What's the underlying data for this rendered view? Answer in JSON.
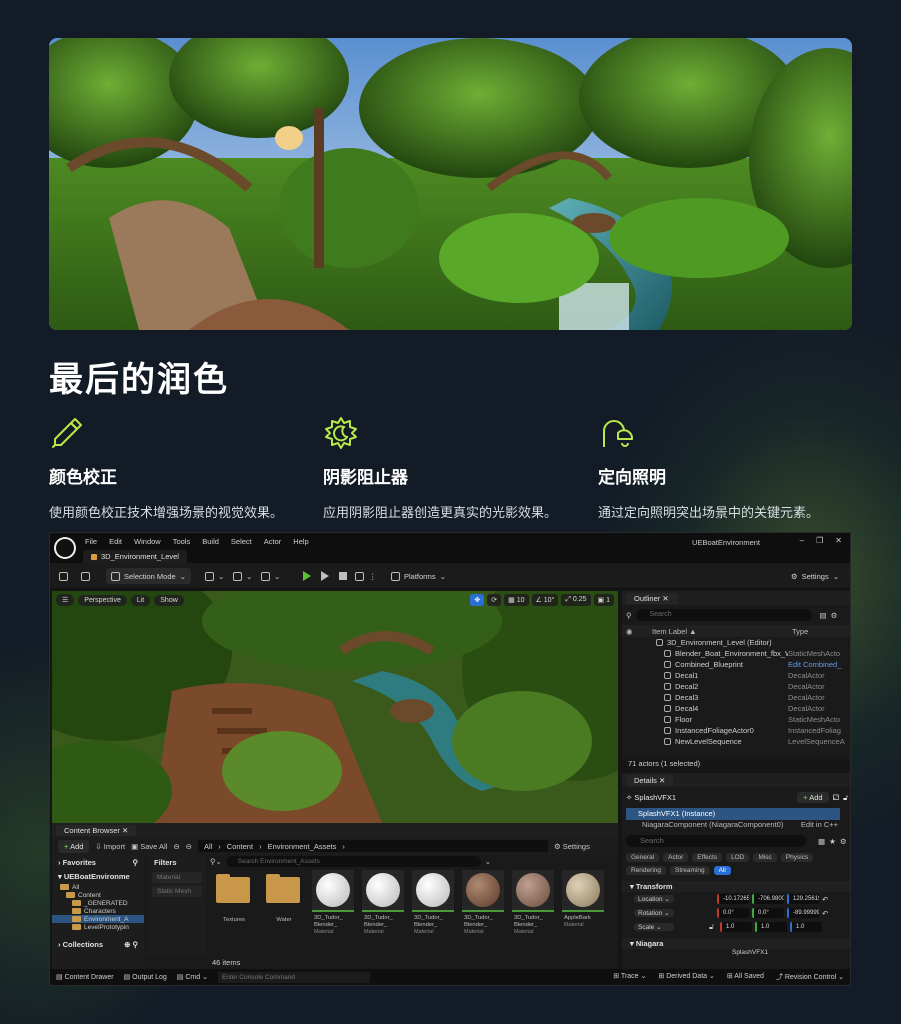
{
  "section_title": "最后的润色",
  "features": [
    {
      "icon": "eyedropper-icon",
      "title": "颜色校正",
      "desc": "使用颜色校正技术增强场景的视觉效果。"
    },
    {
      "icon": "sun-moon-icon",
      "title": "阴影阻止器",
      "desc": "应用阴影阻止器创造更真实的光影效果。"
    },
    {
      "icon": "lamp-icon",
      "title": "定向照明",
      "desc": "通过定向照明突出场景中的关键元素。"
    }
  ],
  "colors": {
    "background": "#131c26",
    "accent": "#b9e84a",
    "selection": "#2d5584",
    "play": "#5bbf3a"
  },
  "editor": {
    "menus": [
      "File",
      "Edit",
      "Window",
      "Tools",
      "Build",
      "Select",
      "Actor",
      "Help"
    ],
    "level_tab": "3D_Environment_Level",
    "app_title": "UEBoatEnvironment",
    "toolbar": {
      "selection_mode": "Selection Mode",
      "platforms": "Platforms",
      "settings": "Settings"
    },
    "viewport": {
      "perspective": "Perspective",
      "lit": "Lit",
      "show": "Show",
      "grid": "10",
      "angle": "10°",
      "scale": "0.25",
      "camera": "1"
    },
    "outliner": {
      "tab": "Outliner",
      "search_placeholder": "Search",
      "col_label": "Item Label ▲",
      "col_type": "Type",
      "rows": [
        {
          "name": "3D_Environment_Level (Editor)",
          "type": ""
        },
        {
          "name": "Blender_Boat_Environment_fbx_W",
          "type": "StaticMeshActo"
        },
        {
          "name": "Combined_Blueprint",
          "type": "Edit Combined_"
        },
        {
          "name": "Decal1",
          "type": "DecalActor"
        },
        {
          "name": "Decal2",
          "type": "DecalActor"
        },
        {
          "name": "Decal3",
          "type": "DecalActor"
        },
        {
          "name": "Decal4",
          "type": "DecalActor"
        },
        {
          "name": "Floor",
          "type": "StaticMeshActo"
        },
        {
          "name": "InstancedFoliageActor0",
          "type": "InstancedFoliag"
        },
        {
          "name": "NewLevelSequence",
          "type": "LevelSequenceA"
        }
      ],
      "footer": "71 actors (1 selected)"
    },
    "details": {
      "tab": "Details",
      "selected": "SplashVFX1",
      "add": "Add",
      "instance": "SplashVFX1 (Instance)",
      "component": "NiagaraComponent (NiagaraComponent0)",
      "component_edit": "Edit in C++",
      "search_placeholder": "Search",
      "filters": [
        "General",
        "Actor",
        "Effects",
        "LOD",
        "Misc",
        "Physics",
        "Rendering",
        "Streaming",
        "All"
      ],
      "transform_label": "Transform",
      "transform": [
        {
          "label": "Location",
          "x": "-10.17265",
          "y": "-706.9800",
          "z": "129.25619"
        },
        {
          "label": "Rotation",
          "x": "0.0°",
          "y": "0.0°",
          "z": "-89.99999"
        },
        {
          "label": "Scale",
          "x": "1.0",
          "y": "1.0",
          "z": "1.0"
        }
      ],
      "niagara_label": "Niagara",
      "niagara_value": "SplashVFX1"
    },
    "content_browser": {
      "tab": "Content Browser",
      "add": "Add",
      "import": "Import",
      "save_all": "Save All",
      "crumbs": [
        "All",
        "Content",
        "Environment_Assets"
      ],
      "settings": "Settings",
      "favorites": "Favorites",
      "project": "UEBoatEnvironme",
      "tree": [
        "All",
        "Content",
        "_GENERATED",
        "Characters",
        "Environment_A",
        "LevelPrototypin"
      ],
      "collections": "Collections",
      "filters_label": "Filters",
      "filter_items": [
        "Material",
        "Static Mesh"
      ],
      "search_placeholder": "Search Environment_Assets",
      "assets": [
        {
          "name": "Textures",
          "kind": "folder",
          "tag": ""
        },
        {
          "name": "Water",
          "kind": "folder",
          "tag": ""
        },
        {
          "name": "3D_Tudor_ Blender_",
          "kind": "white",
          "tag": "Material"
        },
        {
          "name": "3D_Tudor_ Blender_",
          "kind": "white",
          "tag": "Material"
        },
        {
          "name": "3D_Tudor_ Blender_",
          "kind": "white",
          "tag": "Material"
        },
        {
          "name": "3D_Tudor_ Blender_",
          "kind": "wood",
          "tag": "Material"
        },
        {
          "name": "3D_Tudor_ Blender_",
          "kind": "wood2",
          "tag": "Material"
        },
        {
          "name": "AppleBark",
          "kind": "bark",
          "tag": "Material"
        }
      ],
      "count": "46 items"
    },
    "status": {
      "drawer": "Content Drawer",
      "output": "Output Log",
      "cmd": "Cmd",
      "console_placeholder": "Enter Console Command",
      "trace": "Trace",
      "derived": "Derived Data",
      "saved": "All Saved",
      "revision": "Revision Control"
    }
  }
}
